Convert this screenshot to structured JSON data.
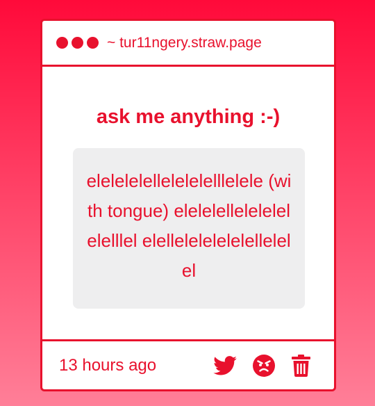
{
  "window": {
    "url": "~ tur11ngery.straw.page",
    "dots": [
      "dot",
      "dot",
      "dot"
    ]
  },
  "main": {
    "title": "ask me anything :-)",
    "question": "elelelelellelelelelllelele (with tongue) elelelellelelelelelelllel elellelelelelelellelelel"
  },
  "footer": {
    "timestamp": "13 hours ago",
    "icons": [
      "twitter-icon",
      "angry-face-icon",
      "trash-icon"
    ]
  },
  "colors": {
    "accent": "#e8112d",
    "box_bg": "#eeeeef",
    "bg_top": "#ff0a3a",
    "bg_bottom": "#ff7f98"
  }
}
